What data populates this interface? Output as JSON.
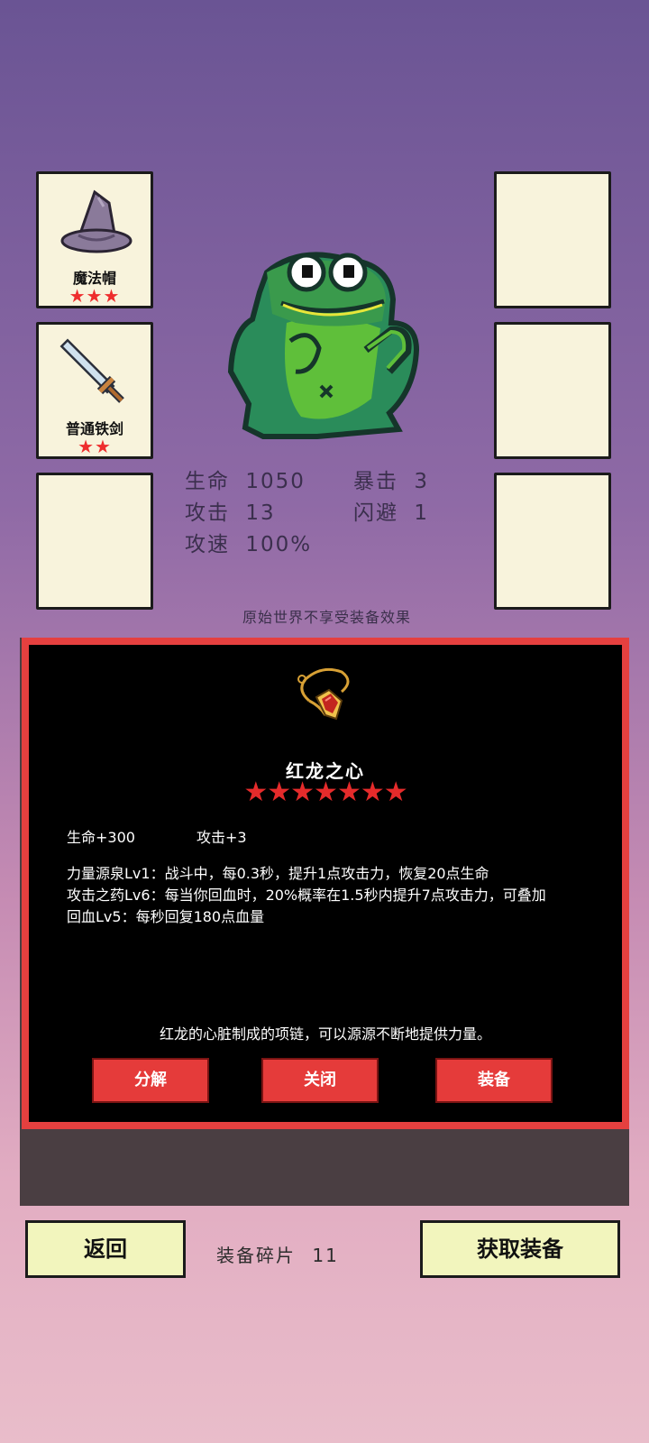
{
  "equipment_slots": {
    "left": [
      {
        "name": "魔法帽",
        "stars": "★★★",
        "icon": "wizard-hat-icon"
      },
      {
        "name": "普通铁剑",
        "stars": "★★",
        "icon": "iron-sword-icon"
      },
      {
        "name": "",
        "stars": "",
        "icon": ""
      }
    ],
    "right": [
      {
        "name": "",
        "stars": ""
      },
      {
        "name": "",
        "stars": ""
      },
      {
        "name": "",
        "stars": ""
      }
    ]
  },
  "character": {
    "sprite": "frog-character",
    "stats": {
      "hp_label": "生命",
      "hp_value": "1050",
      "crit_label": "暴击",
      "crit_value": "3",
      "atk_label": "攻击",
      "atk_value": "13",
      "dodge_label": "闪避",
      "dodge_value": "1",
      "speed_label": "攻速",
      "speed_value": "100%"
    },
    "note": "原始世界不享受装备效果"
  },
  "item_detail": {
    "icon": "ruby-necklace-icon",
    "name": "红龙之心",
    "stars": "★★★★★★★",
    "attr_hp": "生命+300",
    "attr_atk": "攻击+3",
    "skills": [
      "力量源泉Lv1：战斗中，每0.3秒，提升1点攻击力，恢复20点生命",
      "攻击之药Lv6：每当你回血时，20%概率在1.5秒内提升7点攻击力，可叠加",
      "回血Lv5：每秒回复180点血量"
    ],
    "description": "红龙的心脏制成的项链，可以源源不断地提供力量。",
    "buttons": {
      "decompose": "分解",
      "close": "关闭",
      "equip": "装备"
    }
  },
  "footer": {
    "back_label": "返回",
    "shards_label": "装备碎片",
    "shards_value": "11",
    "get_equipment_label": "获取装备"
  },
  "colors": {
    "panel_border": "#e5403f",
    "button_red": "#e53b3a",
    "star_red": "#ee2d2d",
    "slot_bg": "#f8f3dc",
    "footer_button_bg": "#f2f5bd"
  }
}
